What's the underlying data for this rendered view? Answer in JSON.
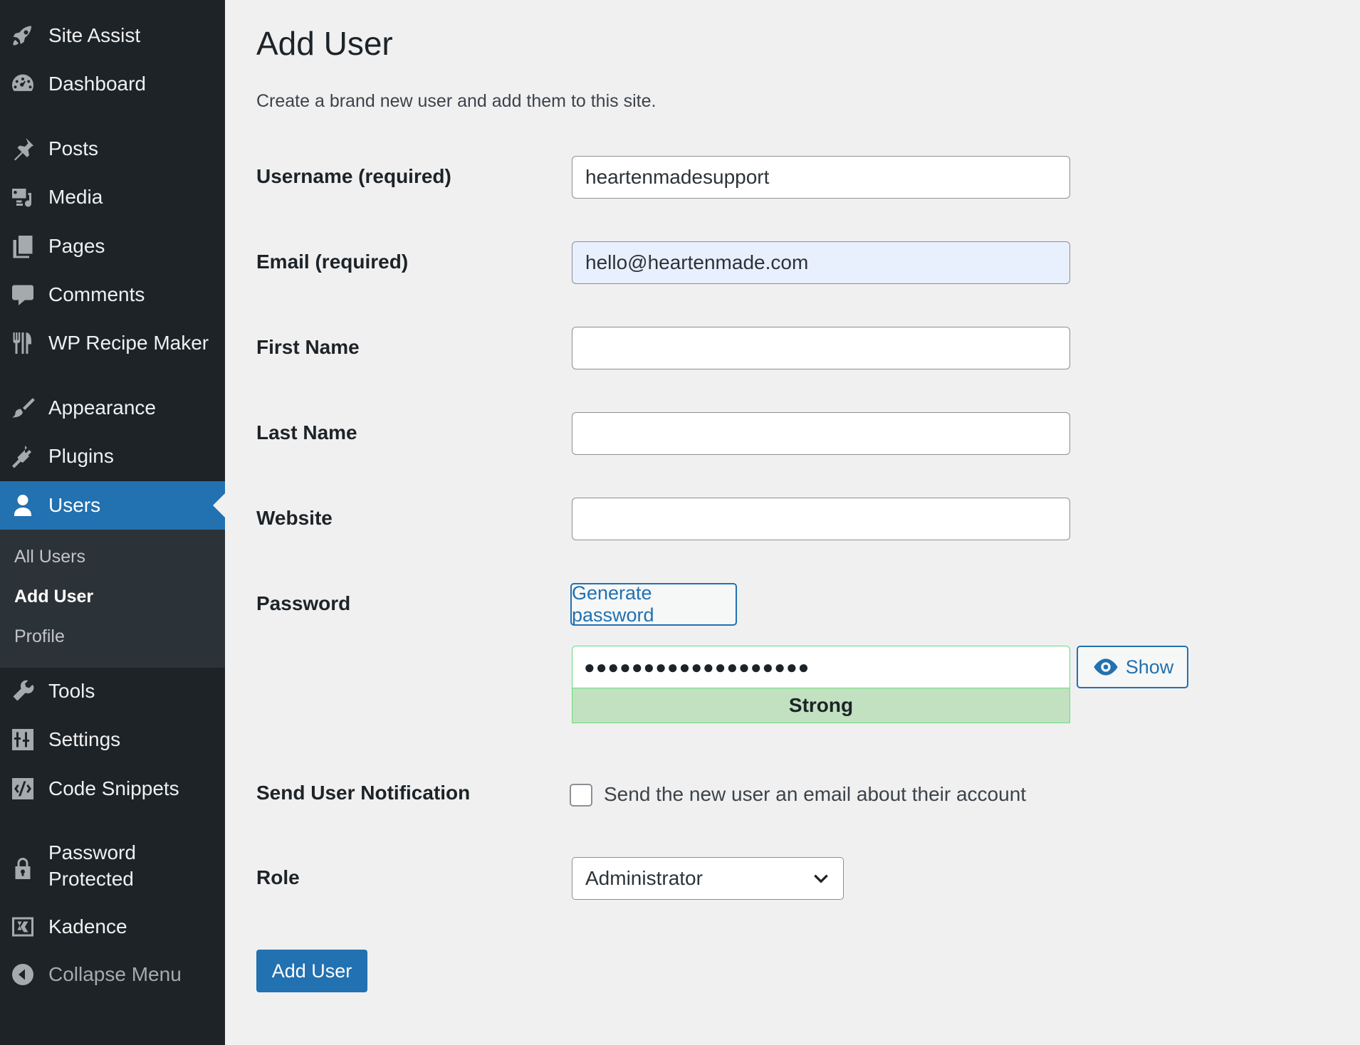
{
  "sidebar": {
    "items": [
      {
        "label": "Site Assist",
        "icon": "rocket-icon"
      },
      {
        "label": "Dashboard",
        "icon": "dashboard-icon"
      },
      {
        "label": "Posts",
        "icon": "pin-icon"
      },
      {
        "label": "Media",
        "icon": "media-icon"
      },
      {
        "label": "Pages",
        "icon": "pages-icon"
      },
      {
        "label": "Comments",
        "icon": "comment-icon"
      },
      {
        "label": "WP Recipe Maker",
        "icon": "utensils-icon"
      },
      {
        "label": "Appearance",
        "icon": "paintbrush-icon"
      },
      {
        "label": "Plugins",
        "icon": "plug-icon"
      },
      {
        "label": "Users",
        "icon": "user-icon",
        "active": true
      },
      {
        "label": "Tools",
        "icon": "wrench-icon"
      },
      {
        "label": "Settings",
        "icon": "settings-icon"
      },
      {
        "label": "Code Snippets",
        "icon": "code-icon"
      },
      {
        "label": "Password Protected",
        "icon": "lock-icon"
      },
      {
        "label": "Kadence",
        "icon": "kadence-icon"
      },
      {
        "label": "Collapse Menu",
        "icon": "collapse-icon"
      }
    ],
    "submenu": [
      {
        "label": "All Users"
      },
      {
        "label": "Add User",
        "current": true
      },
      {
        "label": "Profile"
      }
    ]
  },
  "page": {
    "title": "Add User",
    "description": "Create a brand new user and add them to this site."
  },
  "form": {
    "username_label": "Username (required)",
    "username_value": "heartenmadesupport",
    "email_label": "Email (required)",
    "email_value": "hello@heartenmade.com",
    "first_name_label": "First Name",
    "first_name_value": "",
    "last_name_label": "Last Name",
    "last_name_value": "",
    "website_label": "Website",
    "website_value": "",
    "password_label": "Password",
    "generate_password_label": "Generate password",
    "password_value": "●●●●●●●●●●●●●●●●●●●",
    "password_strength": "Strong",
    "show_label": "Show",
    "notification_label": "Send User Notification",
    "notification_text": "Send the new user an email about their account",
    "notification_checked": false,
    "role_label": "Role",
    "role_value": "Administrator",
    "submit_label": "Add User"
  },
  "colors": {
    "sidebar_bg": "#1d2327",
    "accent": "#2271b1",
    "strength_bg": "#c1e1c1",
    "strength_border": "#68de7c"
  }
}
